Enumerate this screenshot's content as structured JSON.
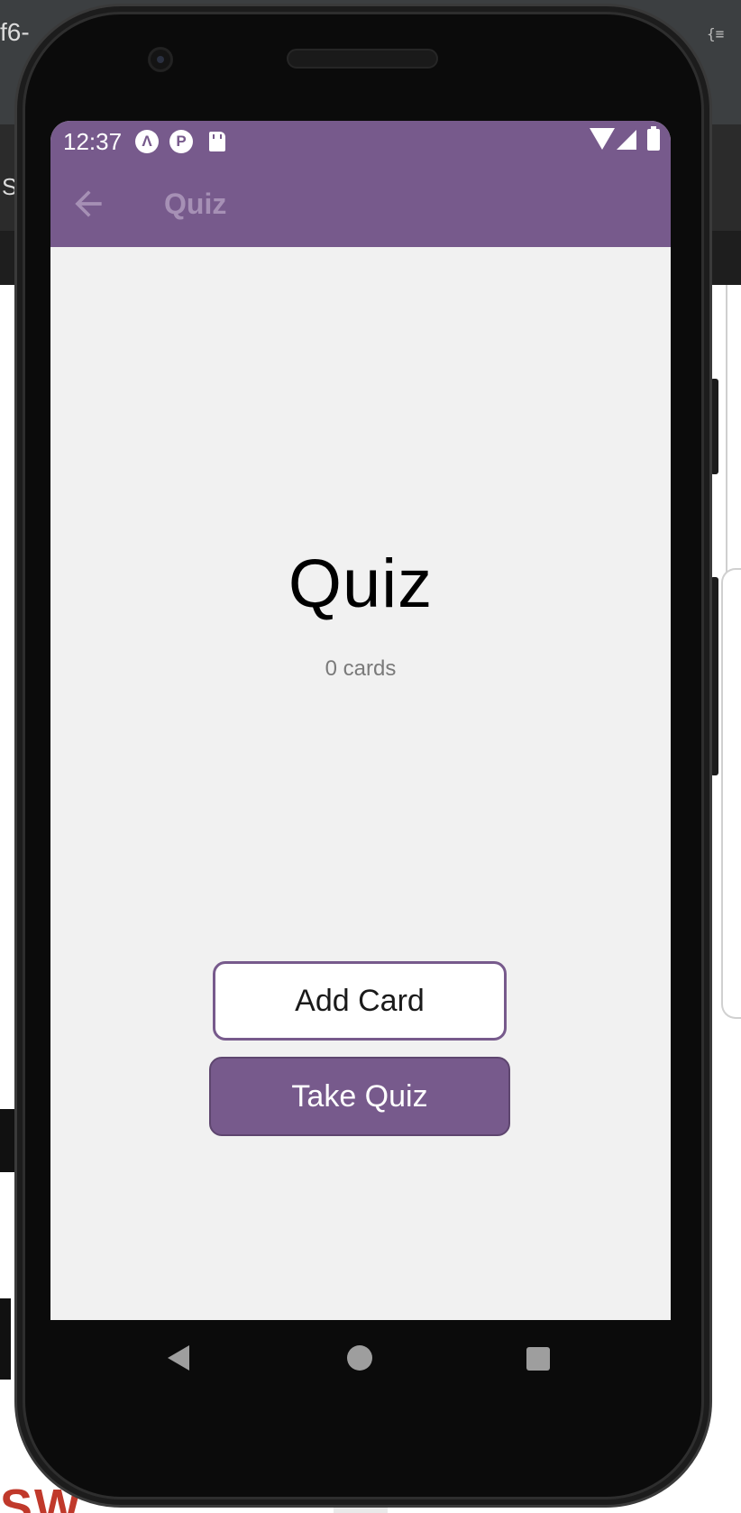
{
  "background": {
    "top_left_fragment": "f6-",
    "top_right_fragment": "{≡",
    "side_fragment": "S",
    "bottom_fragment": "SW"
  },
  "status_bar": {
    "time": "12:37",
    "notification_icons": [
      "a-icon",
      "p-icon",
      "sd-card-icon"
    ],
    "system_icons": [
      "wifi-icon",
      "signal-icon",
      "battery-icon"
    ]
  },
  "app_bar": {
    "title": "Quiz",
    "back_icon": "arrow-back-icon"
  },
  "deck": {
    "title": "Quiz",
    "count_text": "0 cards"
  },
  "actions": {
    "add_card_label": "Add Card",
    "take_quiz_label": "Take Quiz"
  },
  "colors": {
    "primary": "#775a8c",
    "screen_bg": "#f1f1f1",
    "header_title": "#a690b5"
  }
}
